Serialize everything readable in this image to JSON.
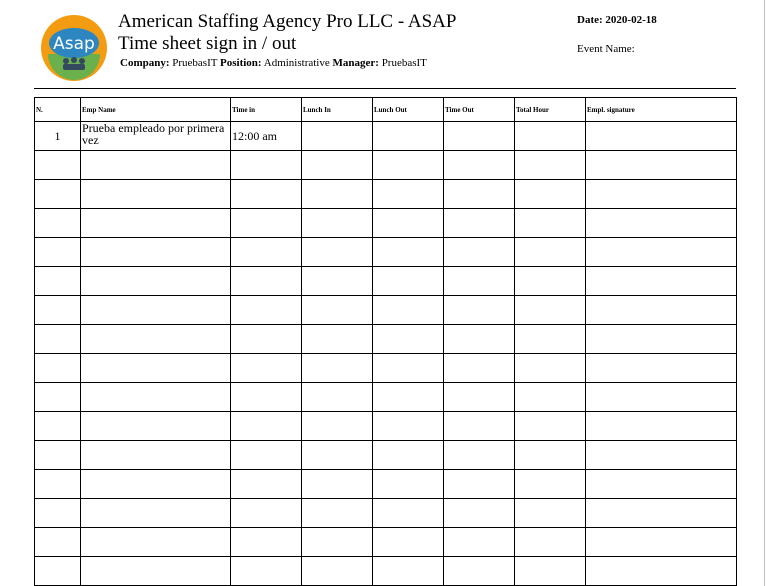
{
  "header": {
    "title": "American Staffing Agency Pro LLC - ASAP",
    "subtitle": "Time sheet sign in / out",
    "company_label": "Company:",
    "company": "PruebasIT",
    "position_label": "Position:",
    "position": "Administrative",
    "manager_label": "Manager:",
    "manager": "PruebasIT",
    "date_label": "Date:",
    "date": "2020-02-18",
    "event_label": "Event Name:",
    "event": ""
  },
  "logo": {
    "text": "Asap",
    "colors": {
      "ring": "#f39c12",
      "inner": "#2e86c1",
      "base": "#6ab04c"
    }
  },
  "table": {
    "columns": [
      "N.",
      "Emp Name",
      "Time in",
      "Lunch In",
      "Lunch Out",
      "Time Out",
      "Total Hour",
      "Empl. signature"
    ],
    "rows": [
      [
        "1",
        "Prueba empleado por primera vez",
        "12:00 am",
        "",
        "",
        "",
        "",
        ""
      ]
    ],
    "blank_rows": 15
  }
}
